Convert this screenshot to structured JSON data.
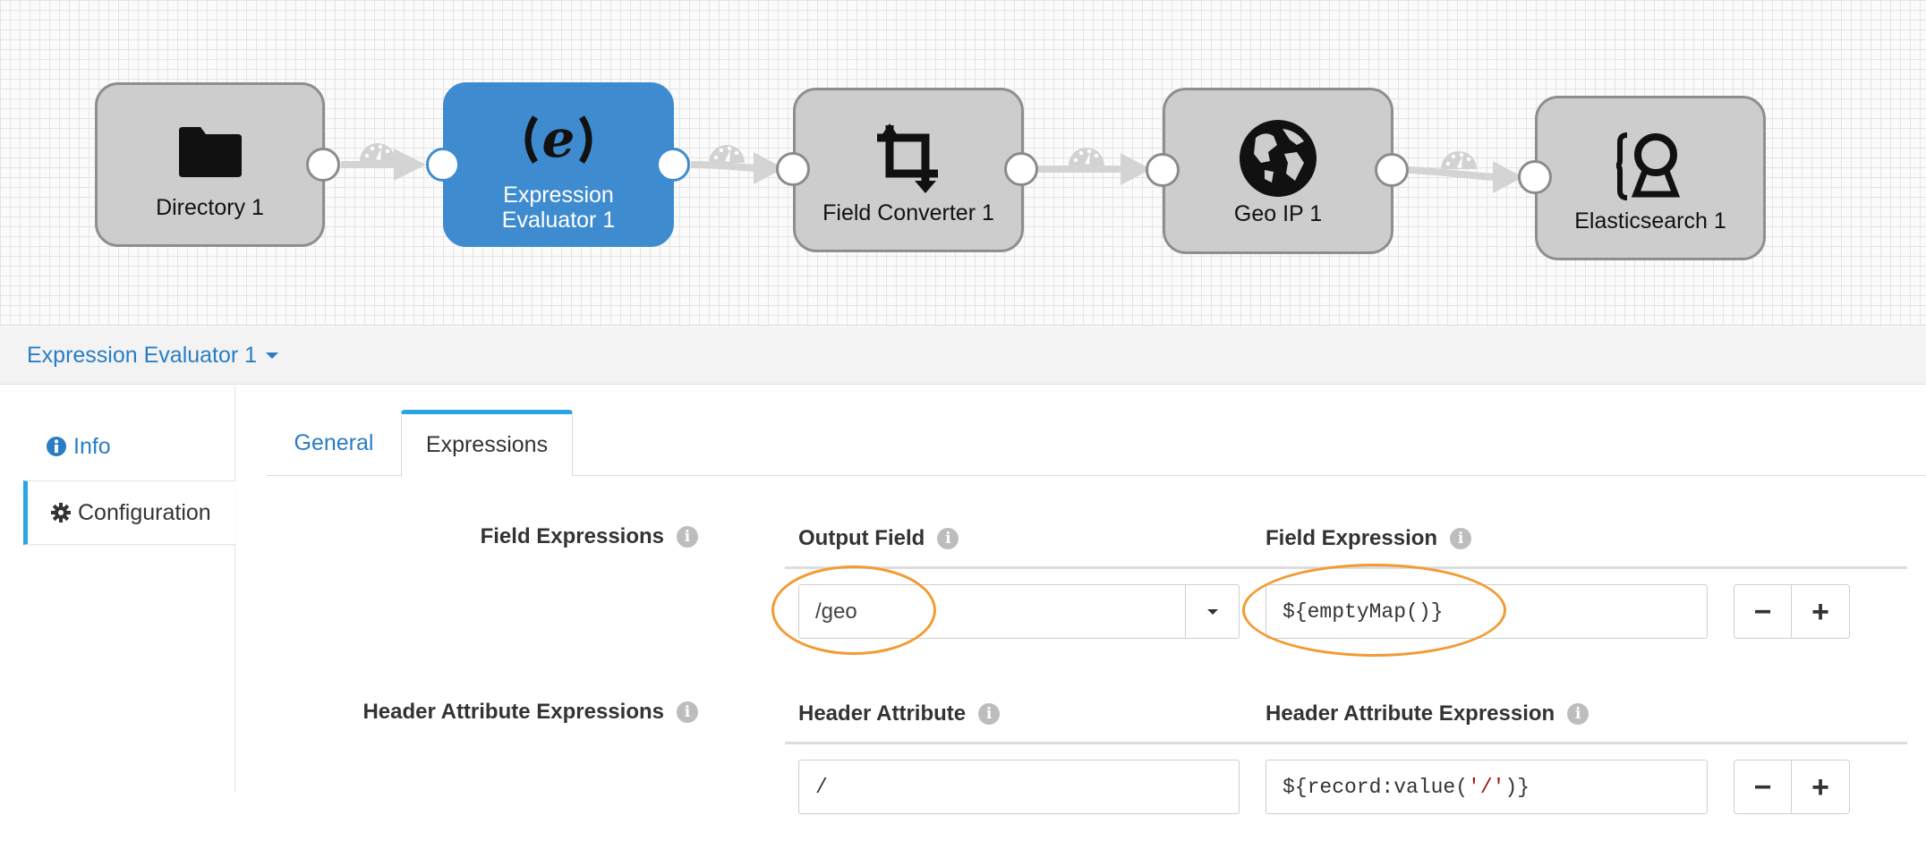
{
  "pipeline": {
    "nodes": [
      {
        "label": "Directory 1",
        "icon": "folder-icon"
      },
      {
        "label": "Expression\nEvaluator 1",
        "icon": "expression-icon",
        "selected": true
      },
      {
        "label": "Field Converter 1",
        "icon": "crop-icon"
      },
      {
        "label": "Geo IP 1",
        "icon": "globe-icon"
      },
      {
        "label": "Elasticsearch 1",
        "icon": "elasticsearch-icon"
      }
    ]
  },
  "stage_bar": {
    "title": "Expression Evaluator 1"
  },
  "side_nav": {
    "info_label": "Info",
    "config_label": "Configuration"
  },
  "tabs": {
    "general": "General",
    "expressions": "Expressions"
  },
  "field_expressions": {
    "label": "Field Expressions",
    "output_field_header": "Output Field",
    "field_expression_header": "Field Expression",
    "output_field_value": "/geo",
    "field_expression_value": "${emptyMap()}"
  },
  "header_attribute_expressions": {
    "label": "Header Attribute Expressions",
    "header_attribute_header": "Header Attribute",
    "header_attribute_expression_header": "Header Attribute Expression",
    "header_attribute_value": "/",
    "expression_prefix": "${record:value(",
    "expression_string": "'/'",
    "expression_suffix": ")}"
  },
  "buttons": {
    "remove": "−",
    "add": "+"
  },
  "info_glyph": "i",
  "colors": {
    "accent": "#3e8ccf",
    "link": "#2a7dc4",
    "tab_active": "#2aa7e3",
    "annotation": "#f39a32",
    "node_fill": "#cdcdcd"
  }
}
